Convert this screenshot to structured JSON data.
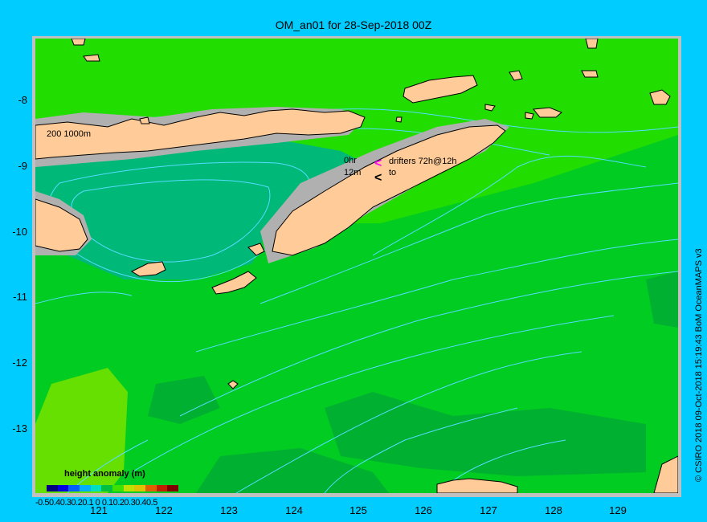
{
  "title": "OM_an01 for 28-Sep-2018 00Z",
  "credit": "© CSIRO 2018   09-Oct-2018 15:19:43 BoM OceanMAPS v3",
  "y_axis": {
    "ticks": [
      "-8",
      "-9",
      "-10",
      "-11",
      "-12",
      "-13"
    ]
  },
  "x_axis": {
    "ticks": [
      "121",
      "122",
      "123",
      "124",
      "125",
      "126",
      "127",
      "128",
      "129"
    ]
  },
  "legend": {
    "title": "height anomaly  (m)",
    "ticks": "-0.50.40.30.20.1 0 0.10.20.30.40.5",
    "colors": [
      "#000080",
      "#0000e0",
      "#0060ff",
      "#00b0ff",
      "#00e0c0",
      "#00c040",
      "#40e000",
      "#c0e000",
      "#e0c000",
      "#e06000",
      "#c02000",
      "#800000"
    ]
  },
  "map_labels": {
    "isobaths": "200  1000m",
    "drifters_0hr": "0hr",
    "drifters_12m": "12m",
    "drifters_line1": "drifters 72h@12h",
    "drifters_line2": "to"
  },
  "colors": {
    "background": "#00ccff",
    "ocean_main": "#00cc22",
    "ocean_lighter": "#22dd00",
    "ocean_darker": "#00b030",
    "ocean_teal": "#00b878",
    "land": "#ffcc99",
    "shelf": "#b0b0b0",
    "contour": "#55ddff",
    "drifter_marker": "#ff00ff"
  }
}
